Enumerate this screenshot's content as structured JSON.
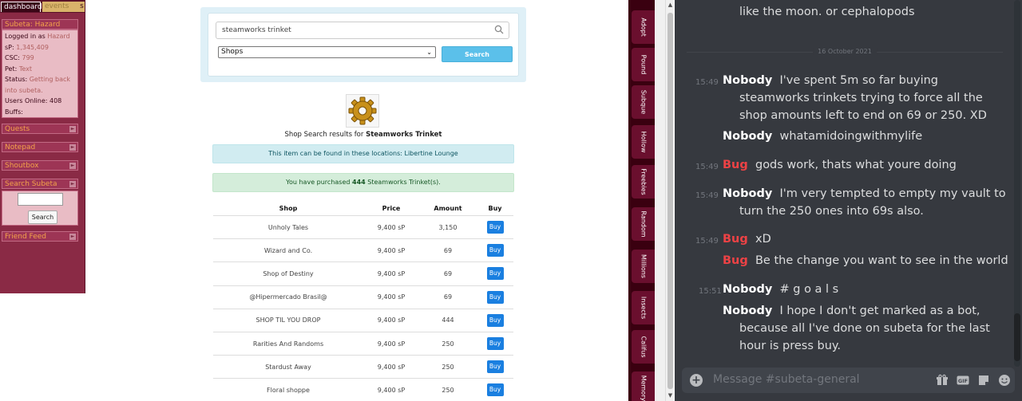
{
  "sidebar": {
    "tabs": {
      "dashboard": "dashboard",
      "events": "events",
      "extra": "s"
    },
    "user_panel": {
      "title": "Subeta: Hazard",
      "logged_label": "Logged in as",
      "logged_value": "Hazard",
      "sp_label": "sP:",
      "sp_value": "1,345,409",
      "csc_label": "CSC:",
      "csc_value": "799",
      "pet_label": "Pet:",
      "pet_value": "Text",
      "status_label": "Status:",
      "status_value_1": "Getting back",
      "status_value_2": "into subeta.",
      "online_label": "Users Online:",
      "online_value": "408",
      "buffs_label": "Buffs:"
    },
    "panels": {
      "quests": "Quests",
      "notepad": "Notepad",
      "shoutbox": "Shoutbox",
      "search": "Search Subeta",
      "friend_feed": "Friend Feed"
    },
    "search_button": "Search"
  },
  "shop_search": {
    "query": "steamworks trinket",
    "type_selected": "Shops",
    "search_button": "Search"
  },
  "results": {
    "prefix": "Shop Search results for",
    "item_name": "Steamworks Trinket",
    "locations_text": "This item can be found in these locations: Libertine Lounge",
    "purchase_prefix": "You have purchased",
    "purchase_count": "444",
    "purchase_suffix": "Steamworks Trinket(s).",
    "headers": {
      "shop": "Shop",
      "price": "Price",
      "amount": "Amount",
      "buy": "Buy"
    },
    "rows": [
      {
        "shop": "Unholy Tales",
        "price": "9,400 sP",
        "amount": "3,150",
        "buy": "Buy"
      },
      {
        "shop": "Wizard and Co.",
        "price": "9,400 sP",
        "amount": "69",
        "buy": "Buy"
      },
      {
        "shop": "Shop of Destiny",
        "price": "9,400 sP",
        "amount": "69",
        "buy": "Buy"
      },
      {
        "shop": "@Hipermercado Brasil@",
        "price": "9,400 sP",
        "amount": "69",
        "buy": "Buy"
      },
      {
        "shop": "SHOP TIL YOU DROP",
        "price": "9,400 sP",
        "amount": "444",
        "buy": "Buy"
      },
      {
        "shop": "Rarities And Randoms",
        "price": "9,400 sP",
        "amount": "250",
        "buy": "Buy"
      },
      {
        "shop": "Stardust Away",
        "price": "9,400 sP",
        "amount": "250",
        "buy": "Buy"
      },
      {
        "shop": "Floral shoppe",
        "price": "9,400 sP",
        "amount": "250",
        "buy": "Buy"
      }
    ]
  },
  "quick_links": [
    "Adopt",
    "Pound",
    "Subque",
    "Hollow",
    "Freebies",
    "Random",
    "Millions",
    "Insects",
    "Califus",
    "Memory"
  ],
  "chat": {
    "top_text": "like the moon. or cephalopods",
    "date_divider": "16 October 2021",
    "messages": [
      {
        "time": "15:49",
        "author": "Nobody",
        "text": "I've spent 5m so far buying",
        "cont": [
          "steamworks trinkets trying to force all the",
          "shop amounts left to end on 69 or 250. XD"
        ]
      },
      {
        "time": "",
        "author": "Nobody",
        "text": "whatamidoingwithmylife",
        "cont": []
      },
      {
        "time": "15:49",
        "author": "Bug",
        "text": "gods work, thats what youre doing",
        "cont": []
      },
      {
        "time": "15:49",
        "author": "Nobody",
        "text": "I'm very tempted to empty my vault to",
        "cont": [
          "turn the 250 ones into 69s also."
        ]
      },
      {
        "time": "15:49",
        "author": "Bug",
        "text": "xD",
        "cont": []
      },
      {
        "time": "",
        "author": "Bug",
        "text": "Be the change you want to see in the world",
        "cont": []
      },
      {
        "time": "15:51",
        "author": "Nobody",
        "text": "# g o a l s",
        "cont": []
      },
      {
        "time": "",
        "author": "Nobody",
        "text": "I hope I don't get marked as a bot,",
        "cont": [
          "because all I've done on subeta for the last",
          "hour is press buy."
        ]
      }
    ],
    "composer_placeholder": "Message #subeta-general"
  },
  "colors": {
    "sidebar_bg": "#8a2a45",
    "search_btn": "#5bc0ea",
    "buy_btn": "#1a7fe0",
    "discord_bg": "#36393f",
    "bug_author": "#ed4245"
  }
}
